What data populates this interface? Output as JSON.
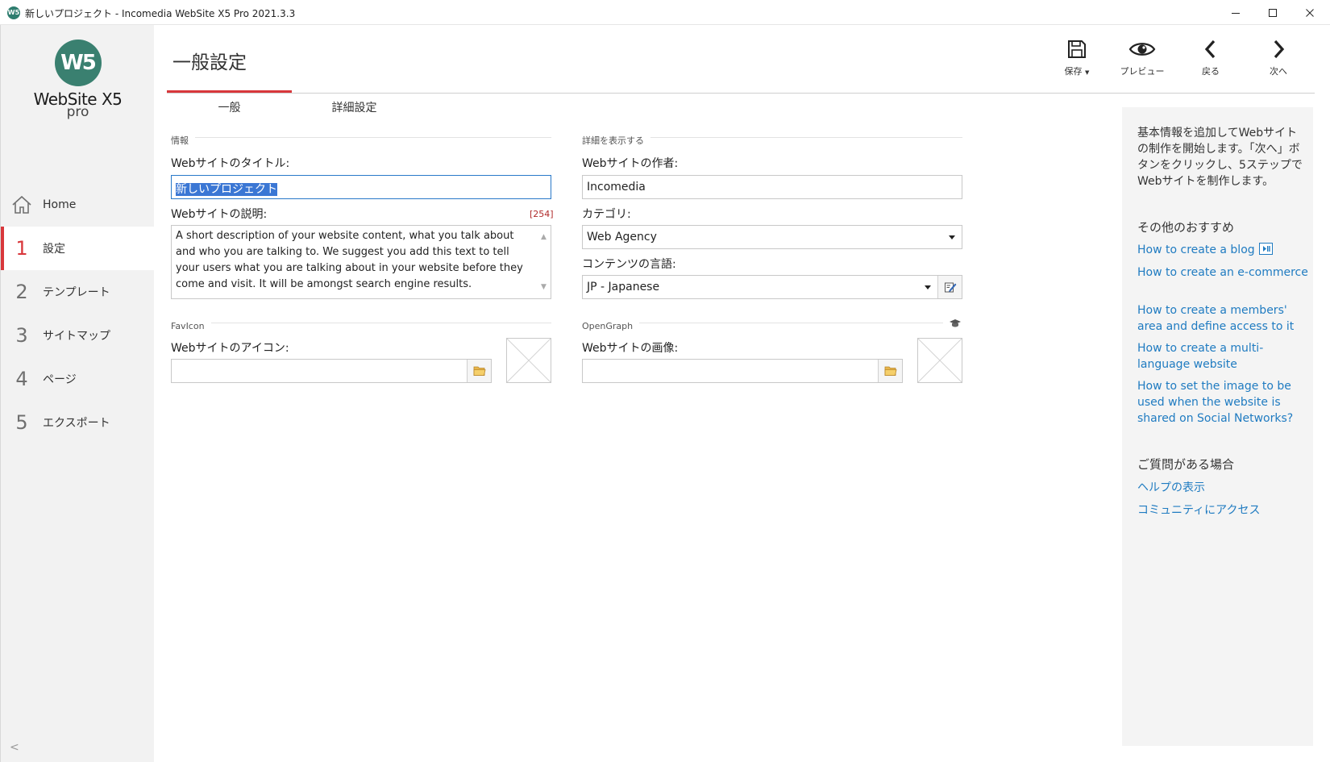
{
  "window": {
    "title": "新しいプロジェクト - Incomedia WebSite X5 Pro 2021.3.3",
    "icon_text": "W5"
  },
  "logo": {
    "mark": "W5",
    "name": "WebSite X5",
    "edition": "pro"
  },
  "nav": {
    "home": "Home",
    "steps": [
      {
        "num": "1",
        "label": "設定"
      },
      {
        "num": "2",
        "label": "テンプレート"
      },
      {
        "num": "3",
        "label": "サイトマップ"
      },
      {
        "num": "4",
        "label": "ページ"
      },
      {
        "num": "5",
        "label": "エクスポート"
      }
    ],
    "active_step": "1",
    "collapse": "<"
  },
  "page": {
    "title": "一般設定"
  },
  "toolbar": {
    "save": "保存",
    "preview": "プレビュー",
    "back": "戻る",
    "next": "次へ"
  },
  "tabs": [
    {
      "label": "一般",
      "active": true
    },
    {
      "label": "詳細設定",
      "active": false
    }
  ],
  "info": {
    "heading": "情報",
    "title_label": "Webサイトのタイトル:",
    "title_value": "新しいプロジェクト",
    "desc_label": "Webサイトの説明:",
    "desc_counter": "[254]",
    "desc_value": "A short description of your website content, what you talk about and who you are talking to. We suggest you add  this text to tell your users what you are talking about in your website before they come and visit. It will be amongst search engine results."
  },
  "details": {
    "heading": "詳細を表示する",
    "author_label": "Webサイトの作者:",
    "author_value": "Incomedia",
    "category_label": "カテゴリ:",
    "category_value": "Web Agency",
    "language_label": "コンテンツの言語:",
    "language_value": "JP - Japanese"
  },
  "favicon": {
    "heading": "FavIcon",
    "label": "Webサイトのアイコン:",
    "value": ""
  },
  "opengraph": {
    "heading": "OpenGraph",
    "label": "Webサイトの画像:",
    "value": ""
  },
  "help": {
    "intro": "基本情報を追加してWebサイトの制作を開始します。「次へ」ボタンをクリックし、5ステップでWebサイトを制作します。",
    "recommend_title": "その他のおすすめ",
    "links": [
      "How to create a blog",
      "How to create an e-commerce",
      "How to create a members' area and define access to it",
      "How to create a multi-language website",
      "How to set the image to be used when the website is shared  on Social Networks?"
    ],
    "question_title": "ご質問がある場合",
    "support_links": [
      "ヘルプの表示",
      "コミュニティにアクセス"
    ]
  },
  "colors": {
    "accent": "#d8373b",
    "link": "#1f7bc1",
    "logo": "#3a8070",
    "sidebar_bg": "#f2f2f2",
    "help_bg": "#f4f4f4"
  }
}
